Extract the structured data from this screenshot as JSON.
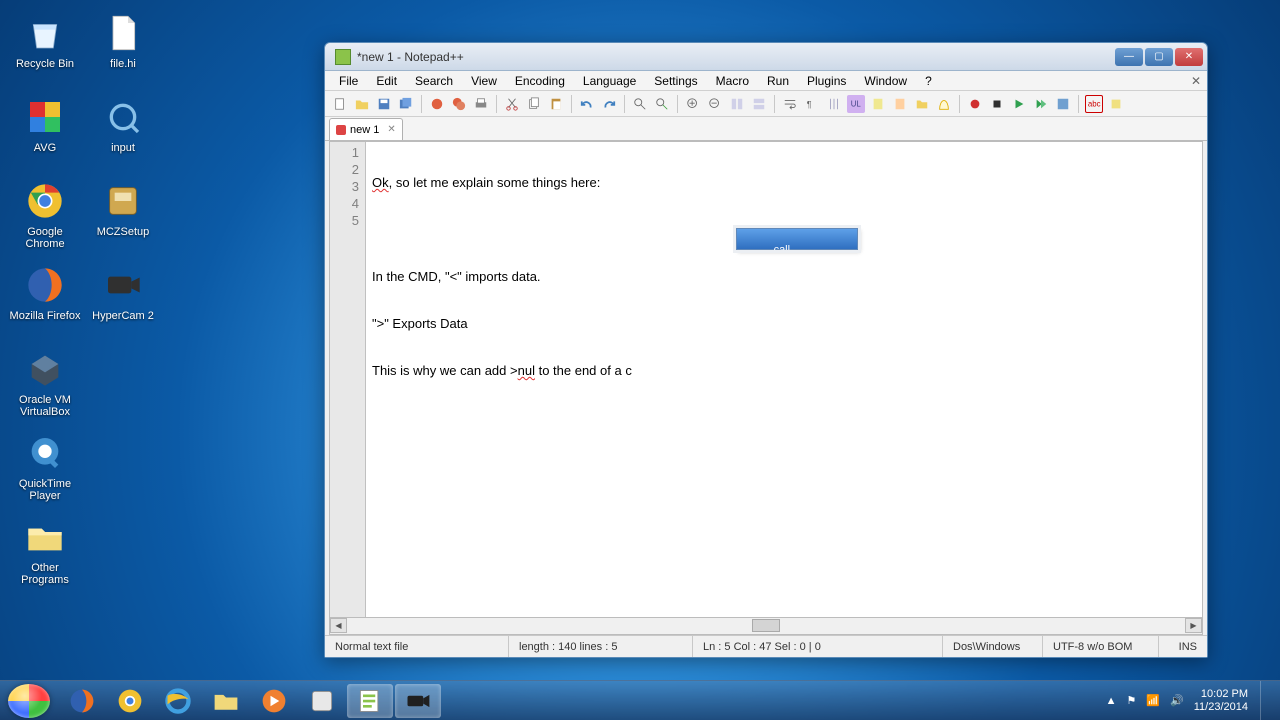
{
  "desktop": {
    "icons": [
      {
        "label": "Recycle Bin",
        "name": "recycle-bin"
      },
      {
        "label": "file.hi",
        "name": "file-hi"
      },
      {
        "label": "AVG",
        "name": "avg"
      },
      {
        "label": "input",
        "name": "input-file"
      },
      {
        "label": "Google Chrome",
        "name": "google-chrome"
      },
      {
        "label": "MCZSetup",
        "name": "mczsetup"
      },
      {
        "label": "Mozilla Firefox",
        "name": "mozilla-firefox"
      },
      {
        "label": "HyperCam 2",
        "name": "hypercam2"
      },
      {
        "label": "Oracle VM VirtualBox",
        "name": "oracle-vm-virtualbox"
      },
      {
        "label": "QuickTime Player",
        "name": "quicktime-player"
      },
      {
        "label": "Other Programs",
        "name": "other-programs"
      }
    ]
  },
  "window": {
    "title": "*new 1 - Notepad++"
  },
  "menubar": [
    "File",
    "Edit",
    "Search",
    "View",
    "Encoding",
    "Language",
    "Settings",
    "Macro",
    "Run",
    "Plugins",
    "Window",
    "?"
  ],
  "tab": {
    "label": "new 1"
  },
  "editor": {
    "lines": [
      {
        "n": 1,
        "text_a": "Ok",
        "text_b": ", so let me explain some things here:"
      },
      {
        "n": 2,
        "text_a": "",
        "text_b": ""
      },
      {
        "n": 3,
        "text_a": "",
        "text_b": "In the CMD, \"<\" imports data."
      },
      {
        "n": 4,
        "text_a": "",
        "text_b": "\">\" Exports Data"
      },
      {
        "n": 5,
        "text_a": "",
        "text_b": "This is why we can add >",
        "text_c": "nul",
        "text_d": " to the end of a c"
      }
    ],
    "autocomplete": "call"
  },
  "statusbar": {
    "filetype": "Normal text file",
    "length": "length : 140    lines : 5",
    "pos": "Ln : 5    Col : 47    Sel : 0 | 0",
    "eol": "Dos\\Windows",
    "enc": "UTF-8 w/o BOM",
    "ovr": "INS"
  },
  "taskbar": {
    "time": "10:02 PM",
    "date": "11/23/2014"
  }
}
